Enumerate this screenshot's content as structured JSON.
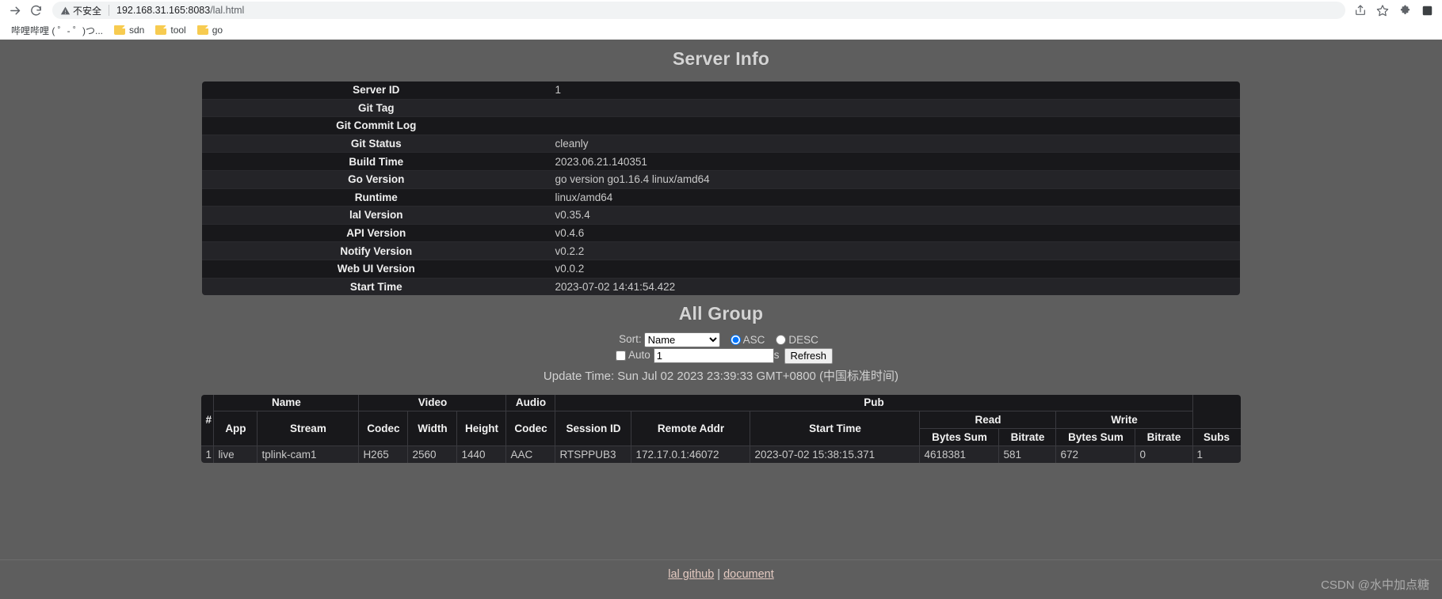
{
  "browser": {
    "security_label": "不安全",
    "url_host": "192.168.31.165:8083",
    "url_path": "/lal.html",
    "icons": {
      "forward": "forward-arrow-icon",
      "reload": "reload-icon",
      "warning": "warning-triangle-icon",
      "share": "share-icon",
      "bookmark": "star-icon",
      "extensions": "puzzle-piece-icon",
      "profile": "profile-square-icon"
    },
    "bookmarks": [
      {
        "label": "哔哩哔哩 ( ゜- ゜)つ...",
        "icon": "bookmark-favicon"
      },
      {
        "label": "sdn",
        "icon": "folder-icon"
      },
      {
        "label": "tool",
        "icon": "folder-icon"
      },
      {
        "label": "go",
        "icon": "folder-icon"
      }
    ]
  },
  "page": {
    "server_info": {
      "title": "Server Info",
      "rows": [
        {
          "key": "Server ID",
          "value": "1"
        },
        {
          "key": "Git Tag",
          "value": ""
        },
        {
          "key": "Git Commit Log",
          "value": ""
        },
        {
          "key": "Git Status",
          "value": "cleanly"
        },
        {
          "key": "Build Time",
          "value": "2023.06.21.140351"
        },
        {
          "key": "Go Version",
          "value": "go version go1.16.4 linux/amd64"
        },
        {
          "key": "Runtime",
          "value": "linux/amd64"
        },
        {
          "key": "lal Version",
          "value": "v0.35.4"
        },
        {
          "key": "API Version",
          "value": "v0.4.6"
        },
        {
          "key": "Notify Version",
          "value": "v0.2.2"
        },
        {
          "key": "Web UI Version",
          "value": "v0.0.2"
        },
        {
          "key": "Start Time",
          "value": "2023-07-02 14:41:54.422"
        }
      ]
    },
    "all_group": {
      "title": "All Group",
      "controls": {
        "sort_label": "Sort:",
        "sort_selected": "Name",
        "sort_options": [
          "Name"
        ],
        "asc_label": "ASC",
        "desc_label": "DESC",
        "order_selected": "ASC",
        "auto_label": "Auto",
        "auto_checked": false,
        "interval_value": "1",
        "interval_unit": "s",
        "refresh_label": "Refresh"
      },
      "update_time": "Update Time: Sun Jul 02 2023 23:39:33 GMT+0800 (中国标准时间)",
      "table": {
        "group_headers": {
          "index": "#",
          "name": "Name",
          "video": "Video",
          "audio": "Audio",
          "pub": "Pub",
          "read": "Read",
          "write": "Write",
          "subs": "Subs"
        },
        "sub_headers": {
          "app": "App",
          "stream": "Stream",
          "video_codec": "Codec",
          "width": "Width",
          "height": "Height",
          "audio_codec": "Codec",
          "session_id": "Session ID",
          "remote_addr": "Remote Addr",
          "start_time": "Start Time",
          "read_bytes_sum": "Bytes Sum",
          "read_bitrate": "Bitrate",
          "write_bytes_sum": "Bytes Sum",
          "write_bitrate": "Bitrate"
        },
        "rows": [
          {
            "index": "1",
            "app": "live",
            "stream": "tplink-cam1",
            "video_codec": "H265",
            "width": "2560",
            "height": "1440",
            "audio_codec": "AAC",
            "session_id": "RTSPPUB3",
            "remote_addr": "172.17.0.1:46072",
            "start_time": "2023-07-02 15:38:15.371",
            "read_bytes_sum": "4618381",
            "read_bitrate": "581",
            "write_bytes_sum": "672",
            "write_bitrate": "0",
            "subs": "1"
          }
        ]
      }
    },
    "footer": {
      "github_link": "lal github",
      "separator": "|",
      "document_link": "document"
    },
    "watermark": "CSDN @水中加点糖"
  },
  "colors": {
    "page_background": "#5e5e5e",
    "table_row_dark": "#18181b",
    "table_row_light": "#242428",
    "heading": "#d4d4d4",
    "link": "#e3c9c0"
  }
}
